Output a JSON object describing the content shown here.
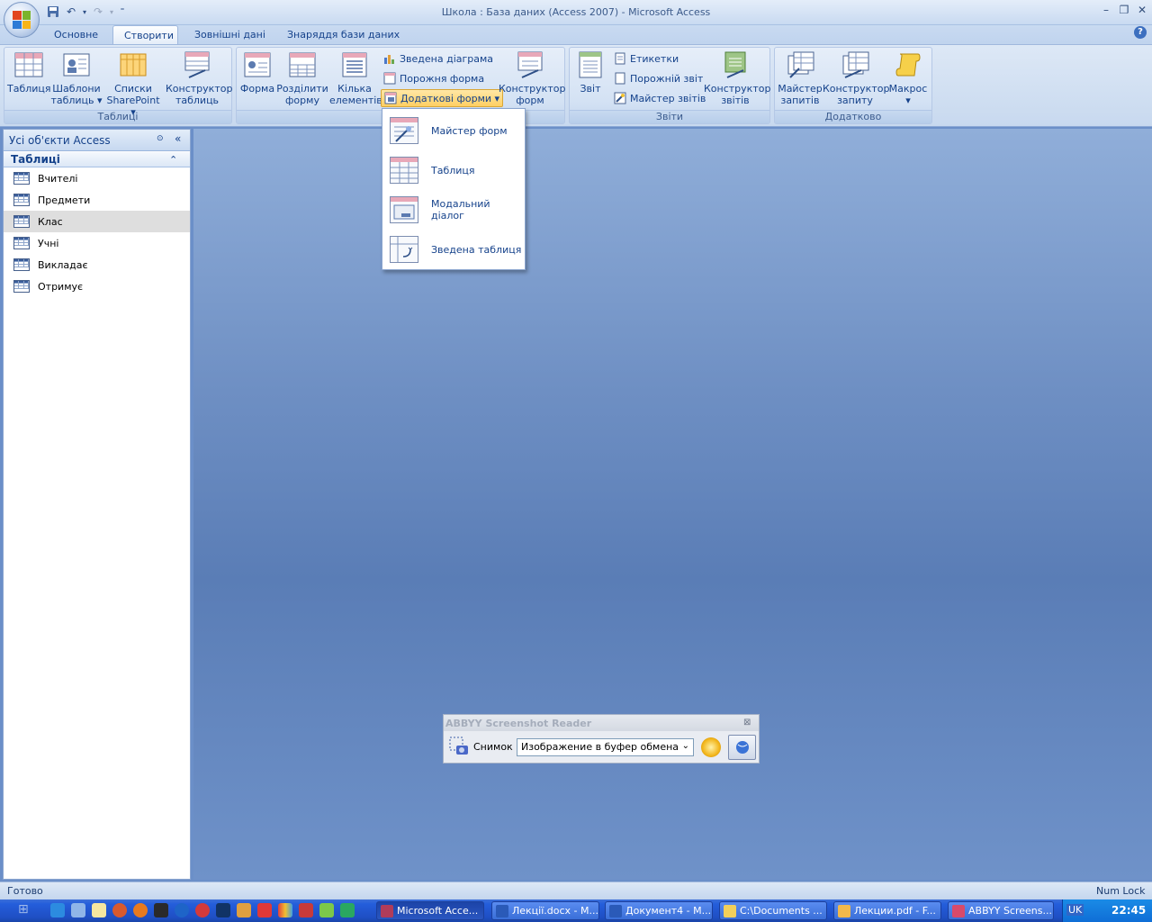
{
  "window": {
    "title": "Школа : База даних (Access 2007)  -  Microsoft Access"
  },
  "tabs": [
    "Основне",
    "Створити",
    "Зовнішні дані",
    "Знаряддя бази даних"
  ],
  "ribbon": {
    "tables": {
      "label": "Таблиці",
      "buttons": [
        {
          "line1": "Таблиця",
          "line2": ""
        },
        {
          "line1": "Шаблони",
          "line2": "таблиць ▾"
        },
        {
          "line1": "Списки",
          "line2": "SharePoint ▾"
        },
        {
          "line1": "Конструктор",
          "line2": "таблиць"
        }
      ]
    },
    "forms": {
      "buttons": [
        {
          "line1": "Форма",
          "line2": ""
        },
        {
          "line1": "Розділити",
          "line2": "форму"
        },
        {
          "line1": "Кілька",
          "line2": "елементів"
        }
      ],
      "small": [
        "Зведена діаграма",
        "Порожня форма",
        "Додаткові форми ▾"
      ],
      "designer": {
        "line1": "Конструктор",
        "line2": "форм"
      }
    },
    "reports": {
      "label": "Звіти",
      "report": "Звіт",
      "small": [
        "Етикетки",
        "Порожній звіт",
        "Майстер звітів"
      ],
      "designer": {
        "line1": "Конструктор",
        "line2": "звітів"
      }
    },
    "other": {
      "label": "Додатково",
      "buttons": [
        {
          "line1": "Майстер",
          "line2": "запитів"
        },
        {
          "line1": "Конструктор",
          "line2": "запиту"
        },
        {
          "line1": "Макрос",
          "line2": "▾"
        }
      ]
    }
  },
  "dropdown": {
    "items": [
      "Майстер форм",
      "Таблиця",
      "Модальний діалог",
      "Зведена таблиця"
    ]
  },
  "navpane": {
    "header": "Усі об'єкти Access",
    "group": "Таблиці",
    "items": [
      "Вчителі",
      "Предмети",
      "Клас",
      "Учні",
      "Викладає",
      "Отримує"
    ],
    "selected": "Клас"
  },
  "abbyy": {
    "title": "ABBYY Screenshot Reader",
    "snap_label": "Снимок",
    "target_value": "Изображение в буфер обмена"
  },
  "status": {
    "left": "Готово",
    "right": "Num Lock"
  },
  "taskbar": {
    "buttons": [
      "Microsoft Acce...",
      "Лекції.docx - M...",
      "Документ4 - M...",
      "C:\\Documents ...",
      "Лекции.pdf - F...",
      "ABBYY Screens..."
    ],
    "lang": "UK",
    "time": "22:45"
  },
  "colors": {
    "accent": "#15428b",
    "workspace": "#6b8fc8",
    "highlight": "#ffcf63",
    "taskbar": "#245edb"
  }
}
